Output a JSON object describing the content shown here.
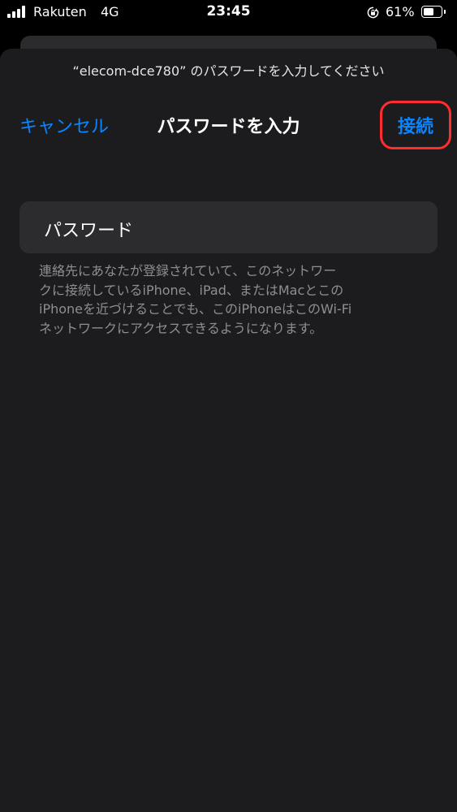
{
  "status_bar": {
    "carrier": "Rakuten",
    "network": "4G",
    "time": "23:45",
    "battery_percent": "61%",
    "battery_level": 0.61,
    "icons": [
      "signal-icon",
      "rotation-lock-icon",
      "battery-icon"
    ]
  },
  "dialog": {
    "prompt": "“elecom-dce780” のパスワードを入力してください",
    "cancel_label": "キャンセル",
    "title": "パスワードを入力",
    "connect_label": "接続",
    "password_label": "パスワード",
    "password_value": "",
    "footer_lines": [
      "連絡先にあなたが登録されていて、このネットワー",
      "クに接続しているiPhone、iPad、またはMacとこの",
      "iPhoneを近づけることでも、このiPhoneはこのWi-Fi",
      "ネットワークにアクセスできるようになります。"
    ]
  },
  "colors": {
    "accent": "#0a84ff",
    "highlight": "#ff2d2d",
    "sheet_background": "#1c1c1e",
    "field_background": "#2c2c2e",
    "secondary_text": "#8e8e93"
  }
}
